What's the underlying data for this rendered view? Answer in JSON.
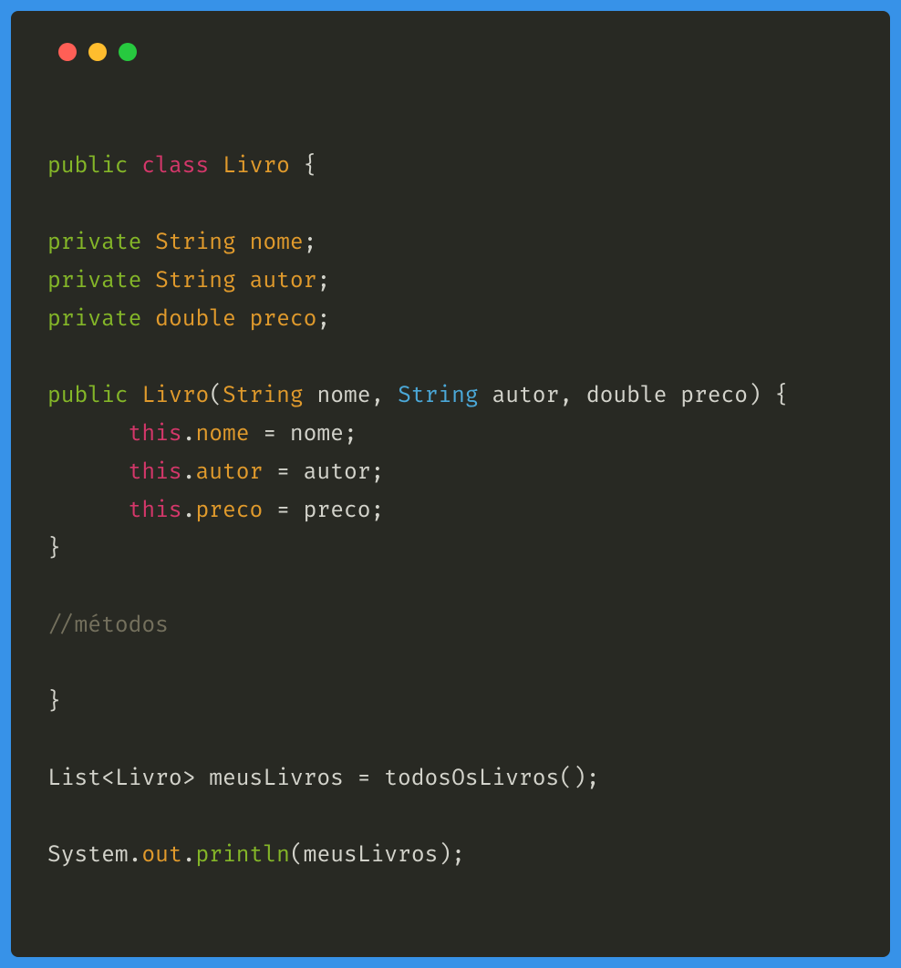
{
  "colors": {
    "red": "#ff5f56",
    "yellow": "#ffbd2e",
    "green": "#27c93f"
  },
  "code": {
    "l1": {
      "public": "public",
      "class": "class",
      "Livro": "Livro",
      "brace": " {"
    },
    "l3": {
      "private": "private",
      "String": "String",
      "nome": "nome",
      "semi": ";"
    },
    "l4": {
      "private": "private",
      "String": "String",
      "autor": "autor",
      "semi": ";"
    },
    "l5": {
      "private": "private",
      "double": "double",
      "preco": "preco",
      "semi": ";"
    },
    "l7": {
      "public": "public",
      "Livro": "Livro",
      "lparen": "(",
      "String1": "String",
      "nome": " nome, ",
      "String2": "String",
      "autor": " autor, double preco",
      "rparen": ")",
      "brace": " {"
    },
    "l8": {
      "indent": "      ",
      "this": "this",
      "dot": ".",
      "prop": "nome",
      "rest": " = nome;"
    },
    "l9": {
      "indent": "      ",
      "this": "this",
      "dot": ".",
      "prop": "autor",
      "rest": " = autor;"
    },
    "l10": {
      "indent": "      ",
      "this": "this",
      "dot": ".",
      "prop": "preco",
      "rest": " = preco;"
    },
    "l11": {
      "brace": "}"
    },
    "l13": {
      "comment": "//métodos"
    },
    "l15": {
      "brace": "}"
    },
    "l17": {
      "text": "List<Livro> meusLivros = todosOsLivros();"
    },
    "l19": {
      "System": "System",
      "dot1": ".",
      "out": "out",
      "dot2": ".",
      "println": "println",
      "lparen": "(",
      "arg": "meusLivros",
      "rparen": ")",
      "semi": ";"
    }
  }
}
